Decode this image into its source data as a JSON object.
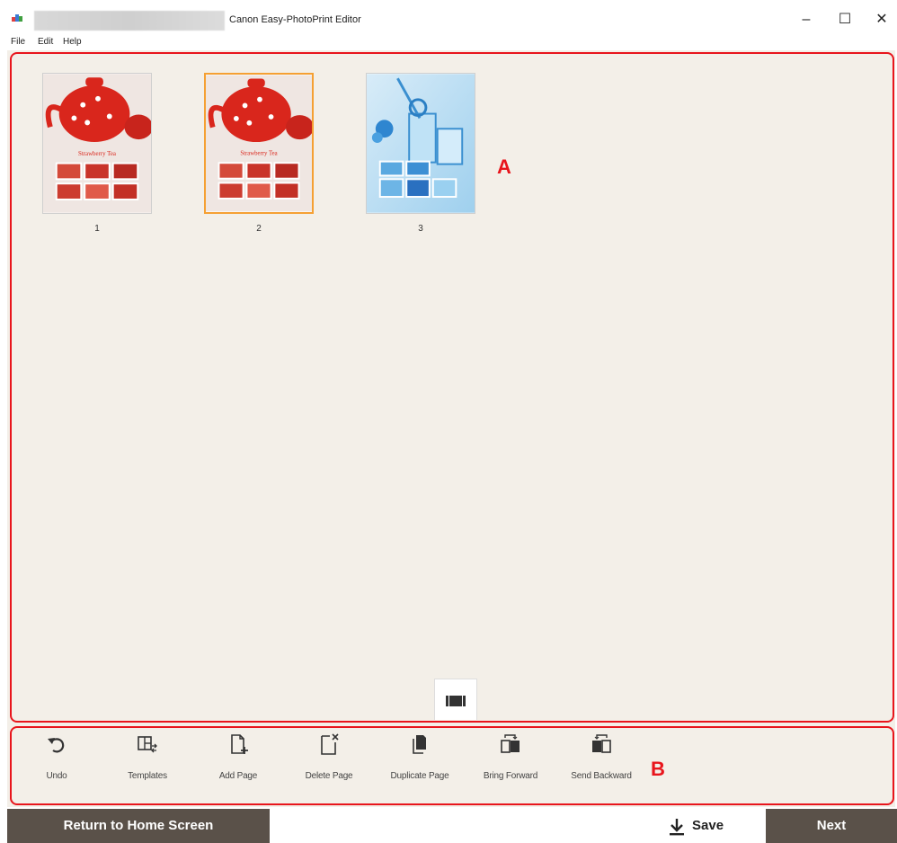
{
  "window": {
    "title": "Canon Easy-PhotoPrint Editor",
    "minimize_glyph": "–",
    "maximize_glyph": "☐",
    "close_glyph": "✕"
  },
  "menu": [
    "File",
    "Edit",
    "Help"
  ],
  "pages": [
    {
      "number": "1",
      "theme": "strawberry-tea-red",
      "caption": "Strawberry Tea",
      "selected": false
    },
    {
      "number": "2",
      "theme": "strawberry-tea-red",
      "caption": "Strawberry Tea",
      "selected": true
    },
    {
      "number": "3",
      "theme": "glassware-blue",
      "selected": false
    }
  ],
  "callouts": {
    "a": "A",
    "b": "B"
  },
  "toolbar": {
    "items": [
      {
        "label": "Undo",
        "icon": "undo-icon"
      },
      {
        "label": "Templates",
        "icon": "templates-icon"
      },
      {
        "label": "Add Page",
        "icon": "add-page-icon"
      },
      {
        "label": "Delete Page",
        "icon": "delete-page-icon"
      },
      {
        "label": "Duplicate Page",
        "icon": "duplicate-page-icon"
      },
      {
        "label": "Bring Forward",
        "icon": "bring-forward-icon"
      },
      {
        "label": "Send Backward",
        "icon": "send-backward-icon"
      }
    ]
  },
  "bottom": {
    "return_label": "Return to Home Screen",
    "save_label": "Save",
    "next_label": "Next"
  },
  "colors": {
    "accent_dark": "#5a5149",
    "selection": "#f5a033",
    "callout": "#e8151c",
    "canvas": "#f3efe8"
  }
}
